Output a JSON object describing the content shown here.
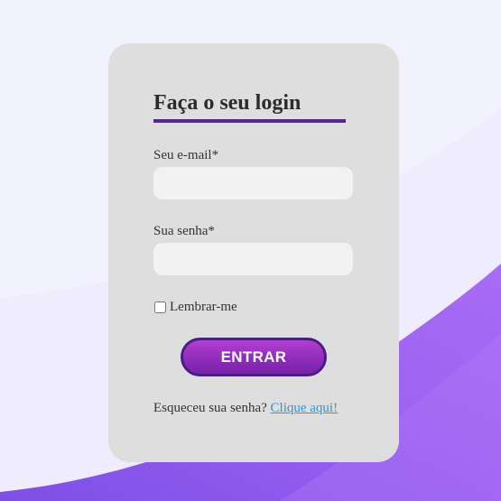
{
  "login": {
    "title": "Faça o seu login",
    "email_label": "Seu e-mail*",
    "email_value": "",
    "password_label": "Sua senha*",
    "password_value": "",
    "remember_label": "Lembrar-me",
    "remember_checked": false,
    "submit_label": "ENTRAR",
    "forgot_text": "Esqueceu sua senha?",
    "forgot_link": "Clique aqui!"
  },
  "colors": {
    "page_background": "#efedfd",
    "card_background": "#dedede",
    "accent_underline": "#57278f",
    "button_gradient_top": "#b43fcf",
    "button_gradient_bottom": "#7a22a8",
    "button_border": "#4a1d86",
    "link": "#1e9bf0",
    "wave_light": "#f6f5fe",
    "wave_purple": "#9a5ef0"
  }
}
